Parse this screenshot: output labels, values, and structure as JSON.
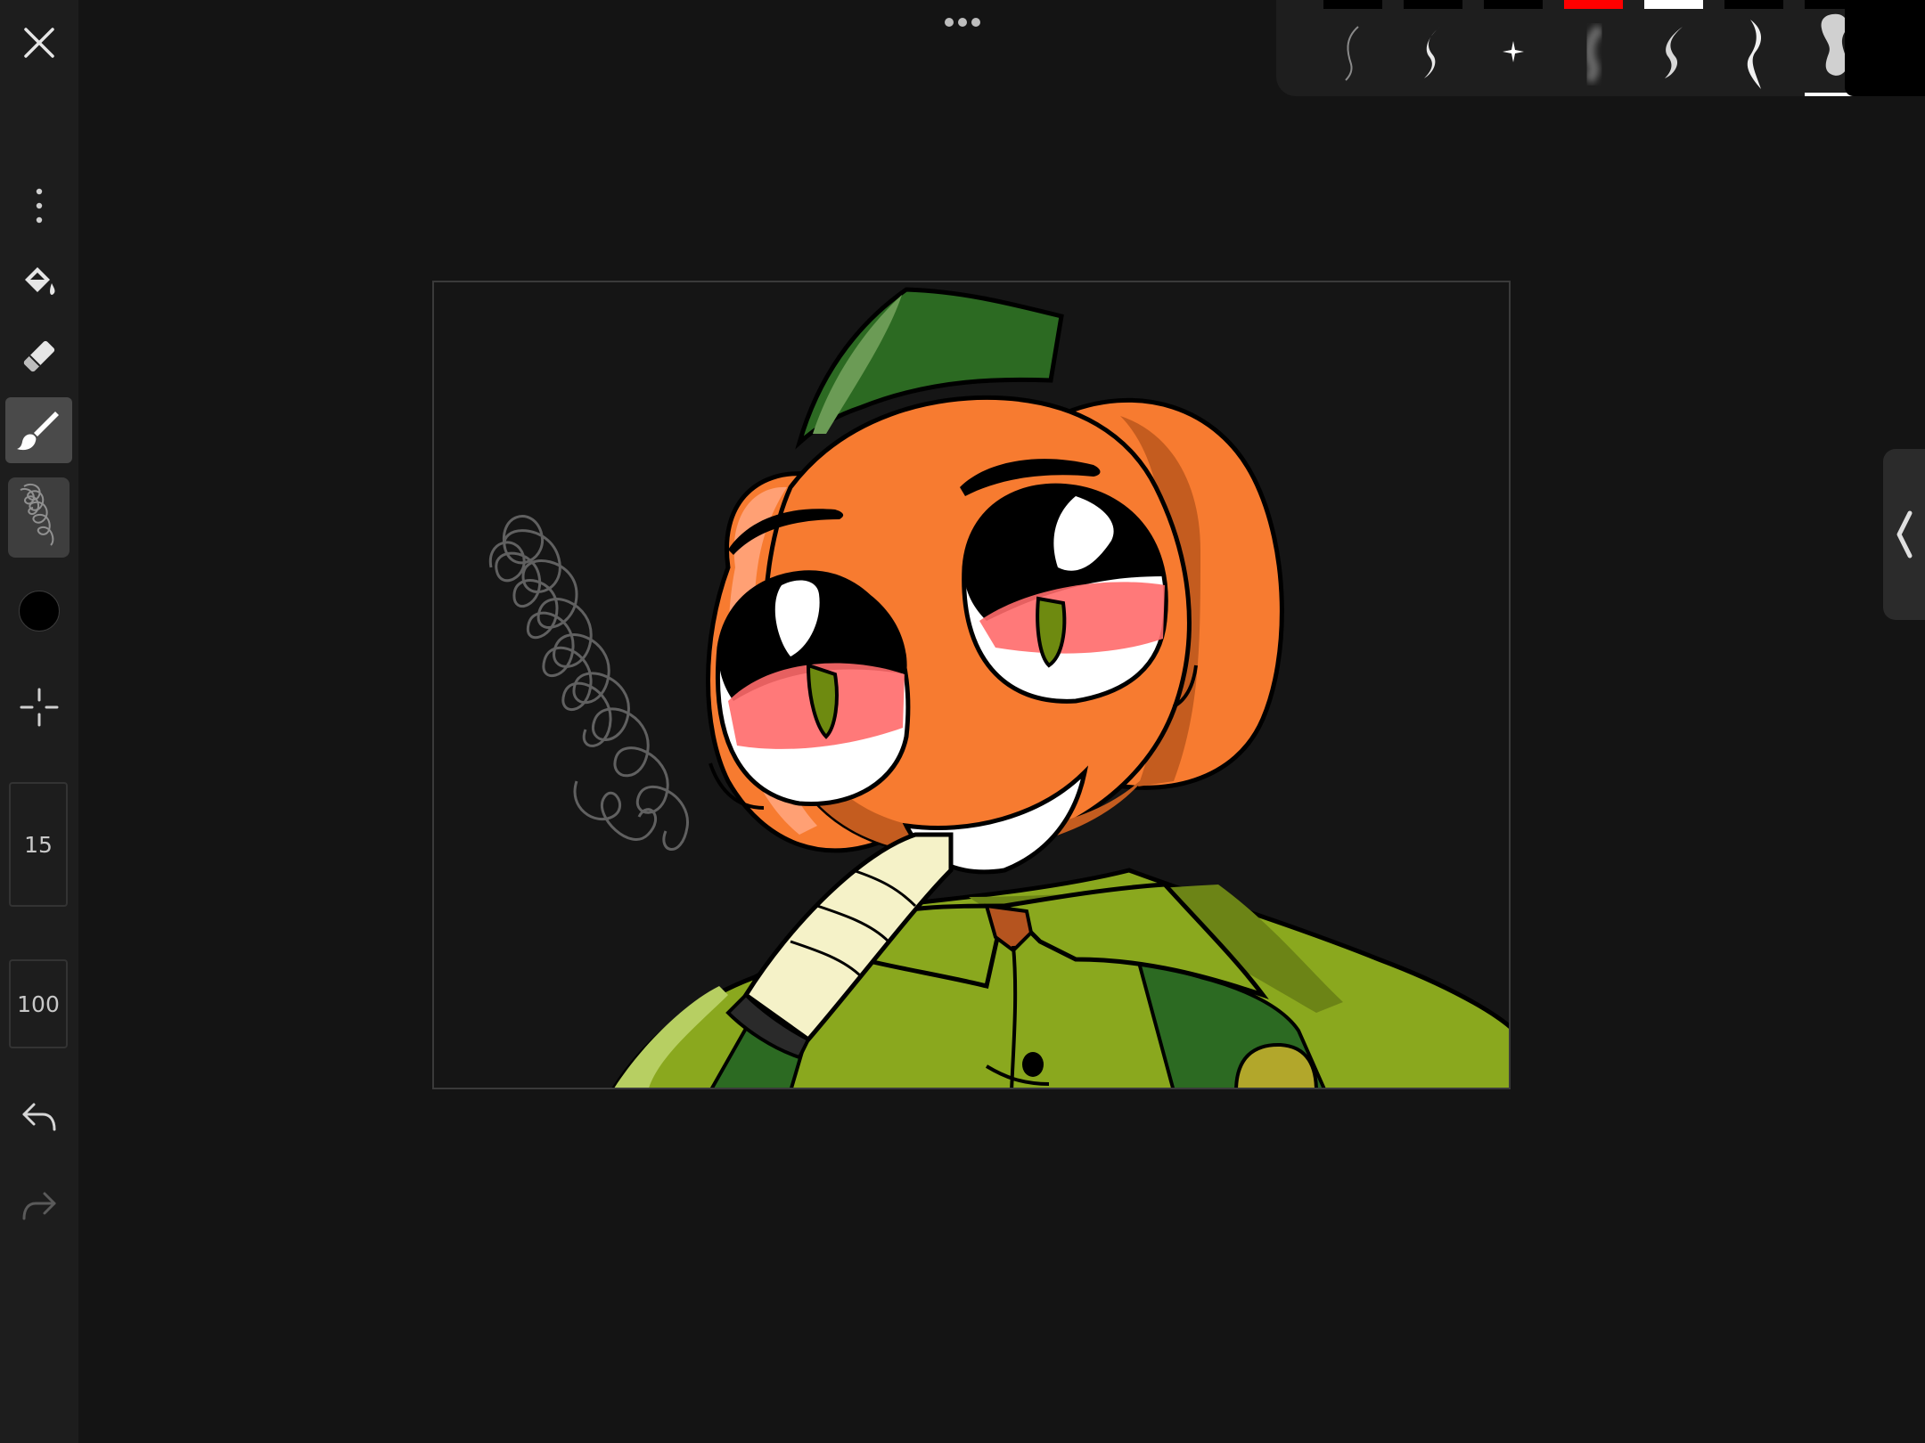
{
  "toolbar": {
    "close": "close",
    "menu": "more-options",
    "tools": [
      "paint-bucket",
      "eraser",
      "brush"
    ],
    "selected_tool": "brush",
    "current_color": "#000000",
    "size_value": "15",
    "opacity_value": "100",
    "undo": "undo",
    "redo": "redo"
  },
  "brush_strip": {
    "brushes": [
      {
        "name": "pencil-thin",
        "tab_color": "#000000"
      },
      {
        "name": "pen",
        "tab_color": "#000000"
      },
      {
        "name": "sparkle",
        "tab_color": "#000000"
      },
      {
        "name": "airbrush",
        "tab_color": "#ff0000"
      },
      {
        "name": "soft-pen",
        "tab_color": "#ffffff"
      },
      {
        "name": "ink",
        "tab_color": "#000000"
      },
      {
        "name": "marker",
        "tab_color": "#000000"
      }
    ],
    "selected_brush": "marker",
    "swatch_color": "#000000"
  },
  "colors": {
    "background": "#141414",
    "toolbar": "#1d1d1d",
    "accent_selected": "#4a4a4a"
  }
}
